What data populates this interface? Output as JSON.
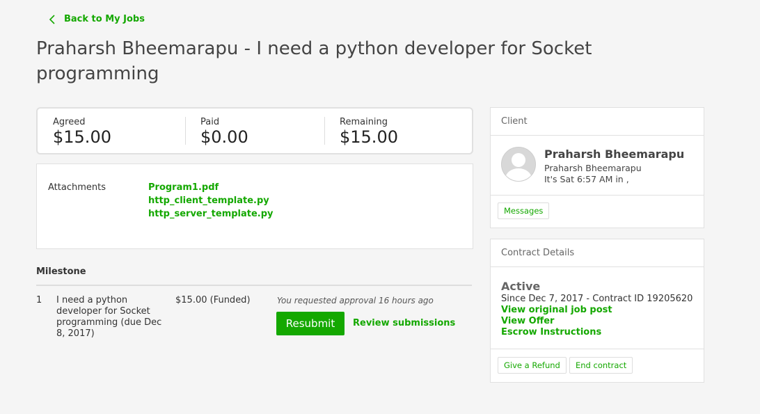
{
  "nav": {
    "back_label": "Back to My Jobs"
  },
  "page": {
    "title": "Praharsh Bheemarapu - I need a python developer for Socket programming"
  },
  "summary": {
    "agreed_label": "Agreed",
    "agreed_value": "$15.00",
    "paid_label": "Paid",
    "paid_value": "$0.00",
    "remaining_label": "Remaining",
    "remaining_value": "$15.00"
  },
  "attachments": {
    "label": "Attachments",
    "files": [
      "Program1.pdf",
      "http_client_template.py",
      "http_server_template.py"
    ]
  },
  "milestones": {
    "header": "Milestone",
    "items": [
      {
        "number": "1",
        "description": "I need a python developer for Socket programming (due Dec 8, 2017)",
        "amount": "$15.00 (Funded)",
        "note": "You requested approval 16 hours ago",
        "resubmit_label": "Resubmit",
        "review_label": "Review submissions"
      }
    ]
  },
  "client": {
    "header": "Client",
    "name": "Praharsh Bheemarapu",
    "subname": "Praharsh Bheemarapu",
    "local_time": "It's Sat 6:57 AM in ,",
    "messages_label": "Messages"
  },
  "contract": {
    "header": "Contract Details",
    "status": "Active",
    "since": "Since Dec 7, 2017 - Contract ID 19205620",
    "links": [
      "View original job post",
      "View Offer",
      "Escrow Instructions"
    ],
    "refund_label": "Give a Refund",
    "end_label": "End contract"
  },
  "colors": {
    "accent": "#14a800",
    "background": "#f5f5f5"
  },
  "icons": {
    "back": "chevron-left-icon",
    "avatar": "user-avatar-icon"
  }
}
